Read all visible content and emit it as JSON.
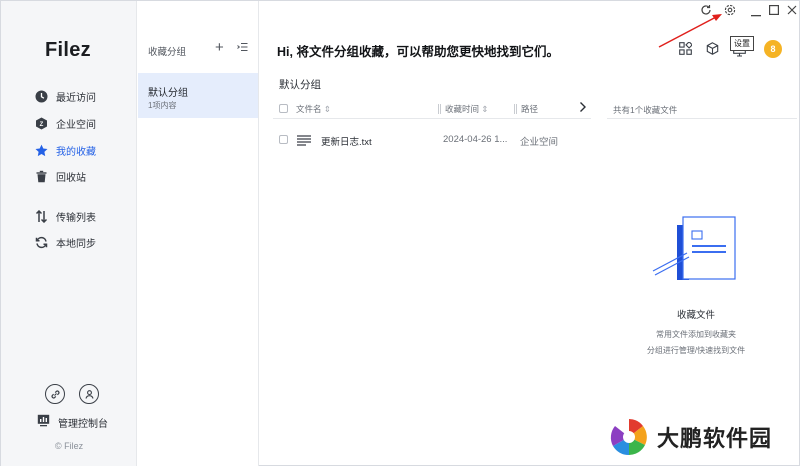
{
  "nav": {
    "logo": "Filez",
    "items": [
      {
        "label": "最近访问",
        "icon": "clock-icon"
      },
      {
        "label": "企业空间",
        "icon": "enterprise-space-icon"
      },
      {
        "label": "我的收藏",
        "icon": "star-icon"
      },
      {
        "label": "回收站",
        "icon": "trash-icon"
      },
      {
        "label": "传输列表",
        "icon": "transfer-icon"
      },
      {
        "label": "本地同步",
        "icon": "sync-icon"
      }
    ],
    "active": "我的收藏",
    "bottom_icons": [
      "link-icon",
      "user-settings-icon"
    ],
    "console_label": "管理控制台",
    "copyright": "© Filez"
  },
  "groups": {
    "header": "收藏分组",
    "add_icon": "plus-icon",
    "sort_icon": "sort-list-icon",
    "items": [
      {
        "name": "默认分组",
        "count": "1项内容"
      }
    ]
  },
  "main": {
    "headline": "Hi, 将文件分组收藏，可以帮助您更快地找到它们。",
    "section_title": "默认分组",
    "columns": [
      "文件名",
      "收藏时间",
      "路径"
    ],
    "rows": [
      {
        "icon": "text-file-icon",
        "name": "更新日志.txt",
        "time": "2024-04-26 1...",
        "path": "企业空间"
      }
    ],
    "side_summary": "共有1个收藏文件",
    "empty": {
      "title": "收藏文件",
      "desc_line1": "常用文件添加到收藏夹",
      "desc_line2": "分组进行管理/快速找到文件"
    }
  },
  "toolbar": {
    "tooltip": "设置",
    "avatar_text": "8",
    "icons": [
      "apps-icon",
      "cube-icon",
      "monitor-icon"
    ],
    "window_icons": [
      "refresh-icon",
      "settings-icon",
      "minimize-icon",
      "maximize-icon",
      "close-icon"
    ]
  },
  "colors": {
    "accent": "#2461e6",
    "active_group_bg": "#e5edfc",
    "avatar": "#f5b324",
    "arrow": "#e0201c"
  },
  "watermark": {
    "text": "大鹏软件园"
  }
}
